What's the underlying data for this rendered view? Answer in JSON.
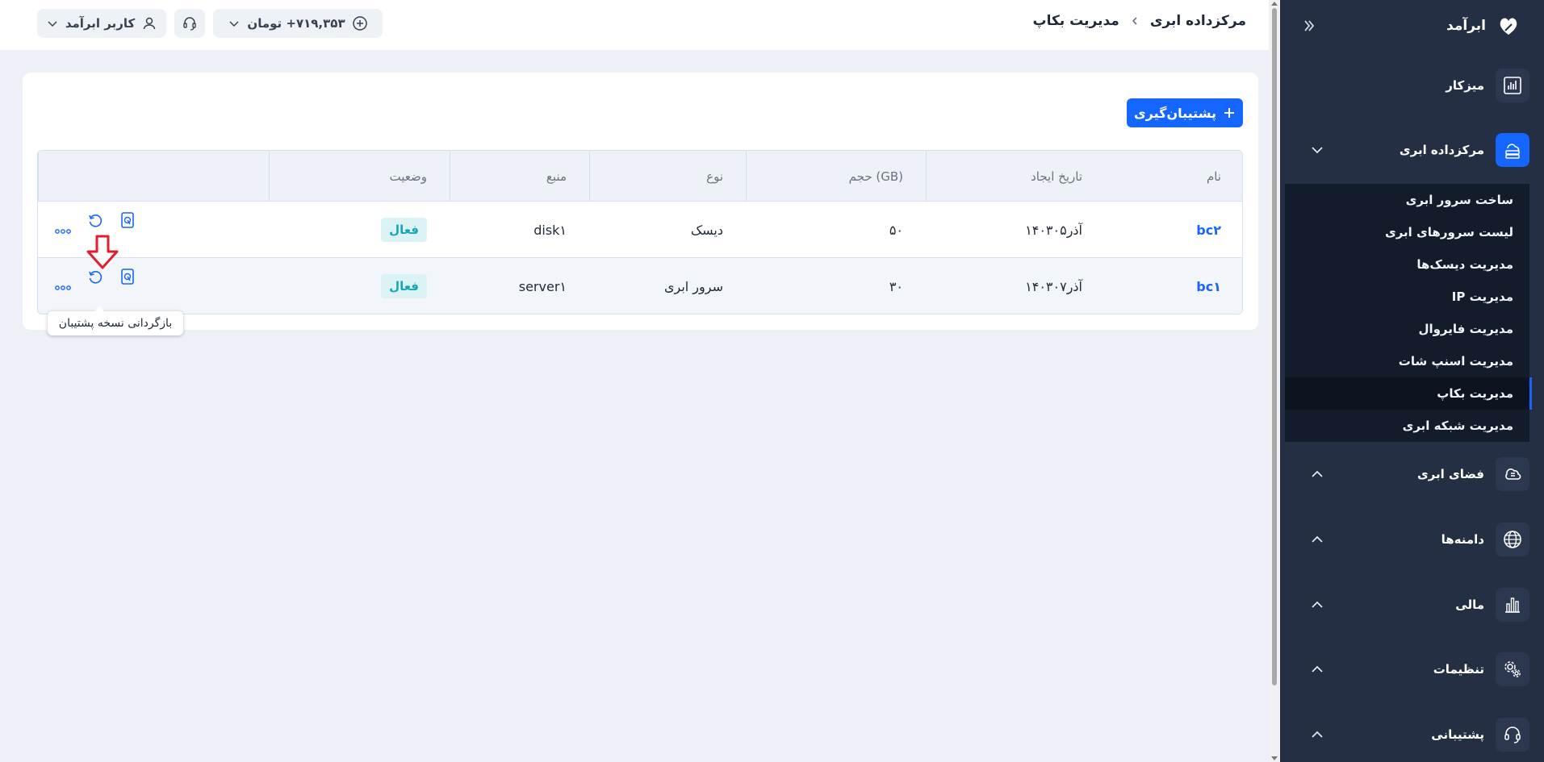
{
  "sidebar": {
    "brand": "ابرآمد",
    "nav": [
      {
        "label": "میزکار",
        "icon": "dashboard-icon"
      },
      {
        "label": "مرکزداده ابری",
        "icon": "cloud-server-icon",
        "active": true
      },
      {
        "label": "فضای ابری",
        "icon": "cloud-storage-icon"
      },
      {
        "label": "دامنه‌ها",
        "icon": "globe-icon"
      },
      {
        "label": "مالی",
        "icon": "finance-chart-icon"
      },
      {
        "label": "تنظیمات",
        "icon": "settings-gear-icon"
      },
      {
        "label": "پشتیبانی",
        "icon": "headset-icon"
      }
    ],
    "submenu": [
      "ساخت سرور ابری",
      "لیست سرورهای ابری",
      "مدیریت دیسک‌ها",
      "مدیریت IP",
      "مدیریت فایروال",
      "مدیریت اسنپ شات",
      "مدیریت بکاپ",
      "مدیریت شبکه ابری"
    ],
    "active_submenu": "مدیریت بکاپ"
  },
  "header": {
    "breadcrumb": [
      "مرکزداده ابری",
      "مدیریت بکاپ"
    ],
    "balance": "۷۱۹,۳۵۳+ تومان",
    "user": "کاربر ابرآمد"
  },
  "main": {
    "add_button": "پشتیبان‌گیری",
    "columns": [
      "نام",
      "تاریخ ایجاد",
      "حجم (GB)",
      "نوع",
      "منبع",
      "وضعیت"
    ],
    "rows": [
      {
        "name": "bc۲",
        "created": "۱۴۰۳آذر۰۵",
        "size": "۵۰",
        "type": "دیسک",
        "source": "disk۱",
        "status": "فعال"
      },
      {
        "name": "bc۱",
        "created": "۱۴۰۳آذر۰۷",
        "size": "۳۰",
        "type": "سرور ابری",
        "source": "server۱",
        "status": "فعال"
      }
    ],
    "tooltip": "بازگردانی نسخه پشتیبان"
  },
  "colors": {
    "accent": "#1565ff",
    "sidebar_bg": "#242f43",
    "status_text": "#16a6b8",
    "highlight_arrow": "#e11d2e"
  }
}
